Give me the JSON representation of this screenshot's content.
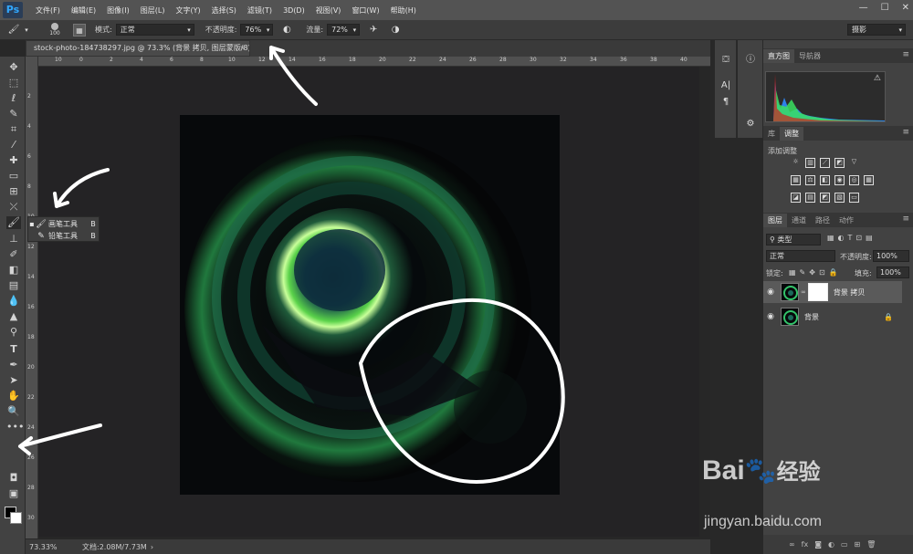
{
  "menu": {
    "logo": "Ps",
    "items": [
      "文件(F)",
      "编辑(E)",
      "图像(I)",
      "图层(L)",
      "文字(Y)",
      "选择(S)",
      "滤镜(T)",
      "3D(D)",
      "视图(V)",
      "窗口(W)",
      "帮助(H)"
    ],
    "window_buttons": [
      "—",
      "☐",
      "✕"
    ]
  },
  "options": {
    "brush_size": "100",
    "mode_label": "模式:",
    "mode_value": "正常",
    "opacity_label": "不透明度:",
    "opacity_value": "76%",
    "flow_label": "流量:",
    "flow_value": "72%",
    "workspace": "摄影"
  },
  "document": {
    "tab_title": "stock-photo-184738297.jpg @ 73.3% (背景 拷贝, 图层蒙版/8) *",
    "close": "×"
  },
  "rulers": {
    "h_ticks": [
      "10",
      "0",
      "2",
      "4",
      "6",
      "8",
      "10",
      "12",
      "14",
      "16",
      "18",
      "20",
      "22",
      "24",
      "26",
      "28",
      "30",
      "32",
      "34",
      "36",
      "38",
      "40"
    ],
    "v_ticks": [
      "2",
      "4",
      "6",
      "8",
      "10",
      "12",
      "14",
      "16",
      "18",
      "20",
      "22",
      "24",
      "26",
      "28",
      "30"
    ]
  },
  "tools": [
    "move-icon",
    "marquee-icon",
    "lasso-icon",
    "quick-select-icon",
    "crop-icon",
    "eyedropper-icon",
    "healing-icon",
    "brush-icon",
    "stamp-icon",
    "history-brush-icon",
    "eraser-icon",
    "gradient-icon",
    "blur-icon",
    "dodge-icon",
    "pen-icon",
    "type-icon",
    "path-select-icon",
    "shape-icon",
    "hand-icon",
    "zoom-icon",
    "more-icon"
  ],
  "flyout": {
    "items": [
      {
        "label": "画笔工具",
        "key": "B",
        "active": true
      },
      {
        "label": "铅笔工具",
        "key": "B",
        "active": false
      }
    ]
  },
  "status": {
    "zoom": "73.33%",
    "doc_info": "文档:2.08M/7.73M"
  },
  "panels": {
    "top_tabs": [
      "直方图",
      "导航器"
    ],
    "mid_tabs": [
      "库",
      "调整"
    ],
    "adjust_title": "添加调整",
    "layer_tabs": [
      "图层",
      "通道",
      "路径",
      "动作"
    ],
    "filter_kind": "类型",
    "blend_mode": "正常",
    "opacity_label": "不透明度:",
    "opacity_value": "100%",
    "lock_label": "锁定:",
    "fill_label": "填充:",
    "fill_value": "100%",
    "layers": [
      {
        "name": "背景 拷贝",
        "has_mask": true,
        "selected": true
      },
      {
        "name": "背景",
        "has_mask": false,
        "selected": false
      }
    ]
  },
  "watermark": {
    "brand": "Bai",
    "brand2": "经验",
    "url": "jingyan.baidu.com"
  }
}
